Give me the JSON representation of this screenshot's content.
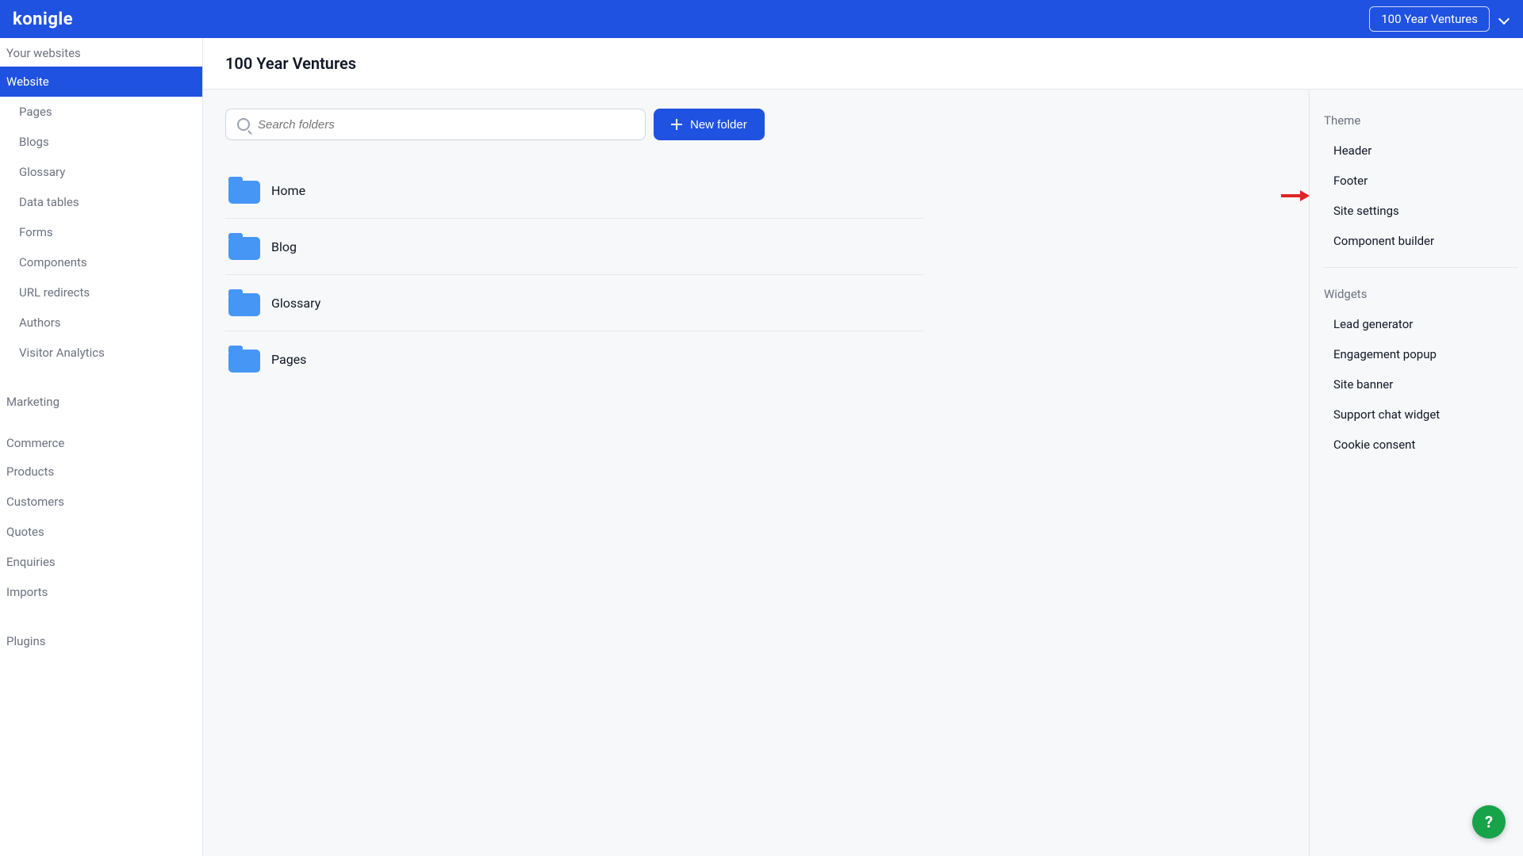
{
  "brand": {
    "name": "konigle"
  },
  "topbar": {
    "workspace_label": "100 Year Ventures"
  },
  "sidebar": {
    "your_websites_label": "Your websites",
    "website": {
      "label": "Website",
      "children": [
        {
          "label": "Pages"
        },
        {
          "label": "Blogs"
        },
        {
          "label": "Glossary"
        },
        {
          "label": "Data tables"
        },
        {
          "label": "Forms"
        },
        {
          "label": "Components"
        },
        {
          "label": "URL redirects"
        },
        {
          "label": "Authors"
        },
        {
          "label": "Visitor Analytics"
        }
      ]
    },
    "marketing_label": "Marketing",
    "commerce": {
      "label": "Commerce",
      "children": [
        {
          "label": "Products"
        },
        {
          "label": "Customers"
        },
        {
          "label": "Quotes"
        },
        {
          "label": "Enquiries"
        },
        {
          "label": "Imports"
        }
      ]
    },
    "plugins_label": "Plugins"
  },
  "page": {
    "title": "100 Year Ventures"
  },
  "toolbar": {
    "search_placeholder": "Search folders",
    "new_folder_label": "New folder"
  },
  "folders": [
    {
      "name": "Home"
    },
    {
      "name": "Blog"
    },
    {
      "name": "Glossary"
    },
    {
      "name": "Pages"
    }
  ],
  "right_panel": {
    "theme": {
      "heading": "Theme",
      "items": [
        {
          "label": "Header"
        },
        {
          "label": "Footer"
        },
        {
          "label": "Site settings"
        },
        {
          "label": "Component builder"
        }
      ]
    },
    "widgets": {
      "heading": "Widgets",
      "items": [
        {
          "label": "Lead generator"
        },
        {
          "label": "Engagement popup"
        },
        {
          "label": "Site banner"
        },
        {
          "label": "Support chat widget"
        },
        {
          "label": "Cookie consent"
        }
      ]
    }
  },
  "help_fab": {
    "glyph": "?"
  },
  "colors": {
    "primary": "#1F52E0",
    "folder": "#4696F6",
    "annotation": "#E02424",
    "fab": "#16A34A"
  }
}
